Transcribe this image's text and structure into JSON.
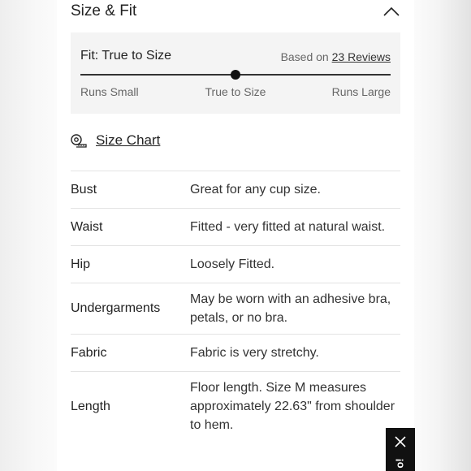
{
  "section": {
    "title": "Size & Fit",
    "collapse_icon": "chevron-up-icon"
  },
  "fit": {
    "label": "Fit: True to Size",
    "reviews_prefix": "Based on",
    "reviews_link": "23 Reviews",
    "scale_position": 0.5,
    "scale": {
      "small": "Runs Small",
      "true": "True to Size",
      "large": "Runs Large"
    }
  },
  "size_chart": {
    "label": "Size Chart",
    "icon": "measuring-tape-icon"
  },
  "specs": [
    {
      "key": "Bust",
      "value": "Great for any cup size."
    },
    {
      "key": "Waist",
      "value": "Fitted - very fitted at natural waist."
    },
    {
      "key": "Hip",
      "value": "Loosely Fitted."
    },
    {
      "key": "Undergarments",
      "value": "May be worn with an adhesive bra, petals, or no bra."
    },
    {
      "key": "Fabric",
      "value": "Fabric is very stretchy."
    },
    {
      "key": "Length",
      "value": "Floor length. Size M measures approximately 22.63\" from shoulder to hem."
    }
  ],
  "overlay_tab": {
    "close_icon": "close-icon",
    "text": "o!"
  },
  "colors": {
    "fit_box_bg": "#f4f4f4",
    "knob": "#111111",
    "overlay_tab_bg": "#111111"
  }
}
